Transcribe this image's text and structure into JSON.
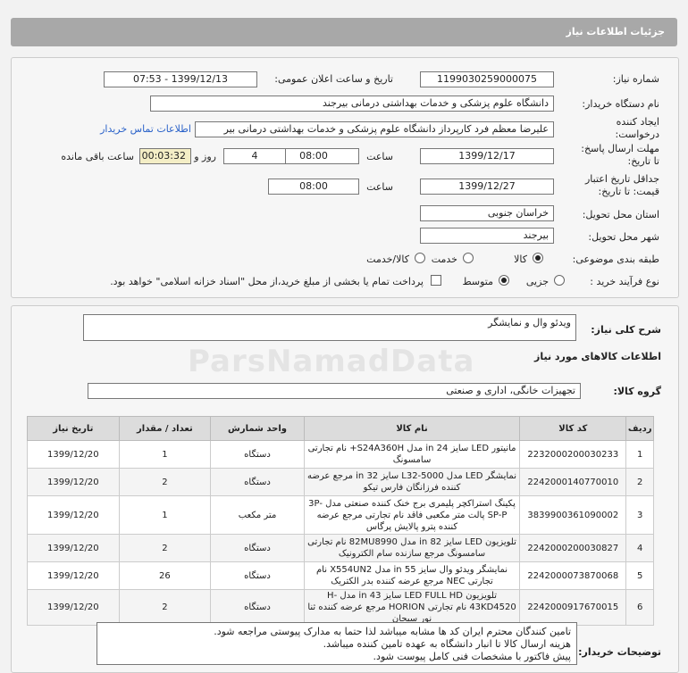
{
  "page_title": "جزئیات اطلاعات نیاز",
  "fields": {
    "need_number_label": "شماره نیاز:",
    "need_number": "1199030259000075",
    "announce_label": "تاریخ و ساعت اعلان عمومی:",
    "announce_value": "1399/12/13 - 07:53",
    "buyer_label": "نام دستگاه خریدار:",
    "buyer_value": "دانشگاه علوم پزشکی و خدمات بهداشتی درمانی بیرجند",
    "creator_label": "ایجاد کننده درخواست:",
    "creator_value": "علیرضا معظم فرد کارپرداز دانشگاه علوم پزشکی و خدمات بهداشتی درمانی بیر",
    "contact_link": "اطلاعات تماس خریدار",
    "reply_label": "مهلت ارسال پاسخ: تا تاریخ:",
    "reply_date": "1399/12/17",
    "time_label": "ساعت",
    "reply_time": "08:00",
    "days_value": "4",
    "days_label": "روز و",
    "remaining_value": "00:03:32",
    "remaining_label": "ساعت باقی مانده",
    "validity_label": "جداقل تاریخ اعتبار قیمت: تا تاریخ:",
    "validity_date": "1399/12/27",
    "validity_time": "08:00",
    "province_label": "استان محل تحویل:",
    "province_value": "خراسان جنوبی",
    "city_label": "شهر محل تحویل:",
    "city_value": "بیرجند",
    "category_label": "طبقه بندی موضوعی:",
    "cat_goods": "کالا",
    "cat_service": "خدمت",
    "cat_both": "کالا/خدمت",
    "process_label": "نوع فرآیند خرید :",
    "proc_small": "جزیی",
    "proc_medium": "متوسط",
    "payment_note": "پرداخت تمام یا بخشی از مبلغ خرید،از محل \"اسناد خزانه اسلامی\" خواهد بود."
  },
  "summary_label": "شرح کلی نیاز:",
  "summary_value": "ویدئو وال و نمایشگر",
  "goods_info_title": "اطلاعات کالاهای مورد نیاز",
  "group_label": "گروه کالا:",
  "group_value": "تجهیزات خانگی، اداری و صنعتی",
  "watermark": "ParsNamadData",
  "table": {
    "headers": [
      "ردیف",
      "کد کالا",
      "نام کالا",
      "واحد شمارش",
      "تعداد / مقدار",
      "تاریخ نیاز"
    ],
    "rows": [
      [
        "1",
        "2232000200030233",
        "مانیتور LED سایز 24 in مدل S24A360H+ نام تجارتی سامسونگ",
        "دستگاه",
        "1",
        "1399/12/20"
      ],
      [
        "2",
        "2242000140770010",
        "نمایشگر LED مدل L32-5000 سایز 32 in مرجع عرضه کننده فرزانگان فارس تیکو",
        "دستگاه",
        "2",
        "1399/12/20"
      ],
      [
        "3",
        "3839900361090002",
        "پکینگ استراکچر پلیمری برج خنک کننده صنعتی مدل 3P-SP-P پالت متر مکعبی فاقد نام تجارتی مرجع عرضه کننده پترو پالایش پرگاس",
        "متر مکعب",
        "1",
        "1399/12/20"
      ],
      [
        "4",
        "2242000200030827",
        "تلویزیون LED سایز 82 in مدل 82MU8990 نام تجارتی سامسونگ مرجع سازنده سام الکترونیک",
        "دستگاه",
        "2",
        "1399/12/20"
      ],
      [
        "5",
        "2242000073870068",
        "نمایشگر ویدئو وال سایز 55 in مدل X554UN2 نام تجارتی NEC مرجع عرضه کننده بدر الکتریک",
        "دستگاه",
        "26",
        "1399/12/20"
      ],
      [
        "6",
        "2242000917670015",
        "تلویزیون LED FULL HD سایز 43 in مدل H-43KD4520 نام تجارتی HORION مرجع عرضه کننده ثنا نور سبحان",
        "دستگاه",
        "2",
        "1399/12/20"
      ]
    ]
  },
  "buyer_notes_label": "توضیحات خریدار:",
  "buyer_notes": [
    "تامین کنندگان محترم ایران کد ها مشابه میباشد لذا حتما به مدارک پیوستی مراجعه شود.",
    "هزینه ارسال کالا تا انبار دانشگاه به عهده تامین کننده میباشد.",
    "پیش فاکتور با مشخصات فنی کامل پیوست شود."
  ]
}
